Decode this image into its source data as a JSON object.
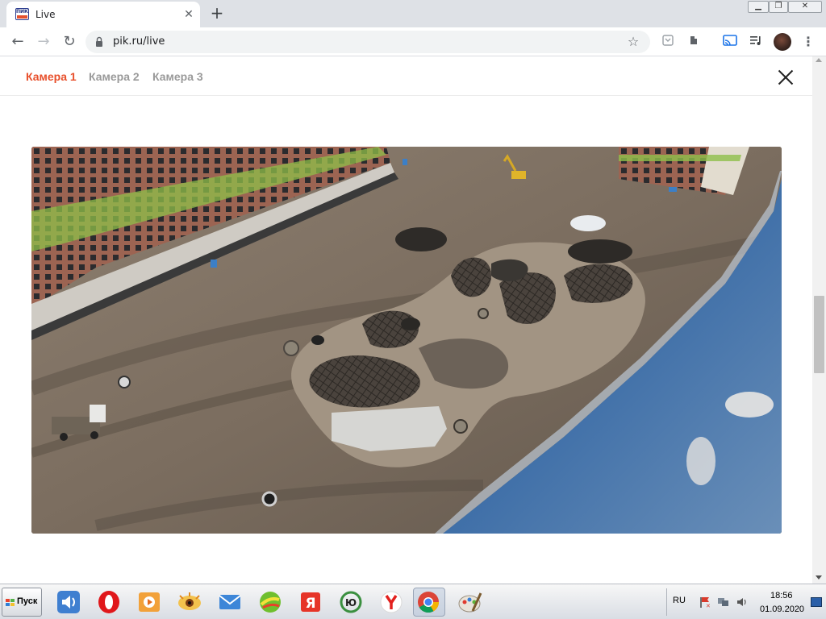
{
  "browser": {
    "tab_title": "Live",
    "favicon_text": "ПИК",
    "url": "pik.ru/live",
    "window_controls": [
      "minimize-icon",
      "restore-icon",
      "close-icon"
    ],
    "extensions": [
      "bookmark-icon",
      "puzzle-icon",
      "cast-icon",
      "playlist-icon"
    ]
  },
  "cameras": {
    "tabs": [
      {
        "label": "Камера 1",
        "active": true
      },
      {
        "label": "Камера 2",
        "active": false
      },
      {
        "label": "Камера 3",
        "active": false
      }
    ],
    "active_color": "#e8502c",
    "inactive_color": "#9a9a9a"
  },
  "taskbar": {
    "start_label": "Пуск",
    "apps": [
      "speaker-icon",
      "opera-icon",
      "media-player-icon",
      "eye-icon",
      "mail-icon",
      "green-ball-icon",
      "yandex-ya-icon",
      "yu-icon",
      "yandex-browser-icon",
      "chrome-icon",
      "paint-icon"
    ],
    "language": "RU",
    "time": "18:56",
    "date": "01.09.2020"
  }
}
